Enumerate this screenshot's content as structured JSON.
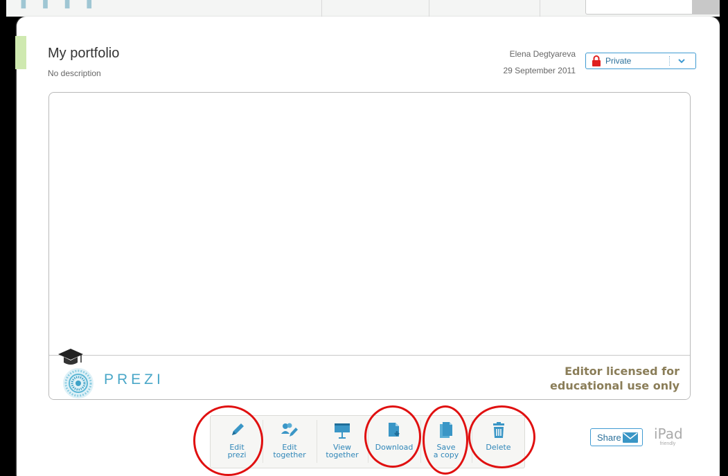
{
  "page": {
    "title": "My portfolio",
    "description": "No description",
    "author": "Elena Degtyareva",
    "date": "29 September 2011"
  },
  "privacy": {
    "label": "Private",
    "icon": "lock-icon"
  },
  "viewer": {
    "logo_text": "PREZI",
    "license_line1": "Editor licensed for",
    "license_line2": "educational use only"
  },
  "toolbar": {
    "buttons": [
      {
        "label": "Edit\nprezi",
        "icon": "pencil-icon",
        "highlighted": true
      },
      {
        "label": "Edit\ntogether",
        "icon": "users-edit-icon",
        "highlighted": false
      },
      {
        "label": "View\ntogether",
        "icon": "projector-icon",
        "highlighted": false
      },
      {
        "label": "Download",
        "icon": "download-icon",
        "highlighted": true
      },
      {
        "label": "Save\na copy",
        "icon": "copy-icon",
        "highlighted": true
      },
      {
        "label": "Delete",
        "icon": "trash-icon",
        "highlighted": true
      }
    ]
  },
  "share": {
    "label": "Share",
    "icon": "envelope-icon"
  },
  "ipad": {
    "label": "iPad",
    "sublabel": "friendly"
  },
  "colors": {
    "accent": "#2f86b8",
    "highlight": "#e01010",
    "license_text": "#8a7d58"
  }
}
